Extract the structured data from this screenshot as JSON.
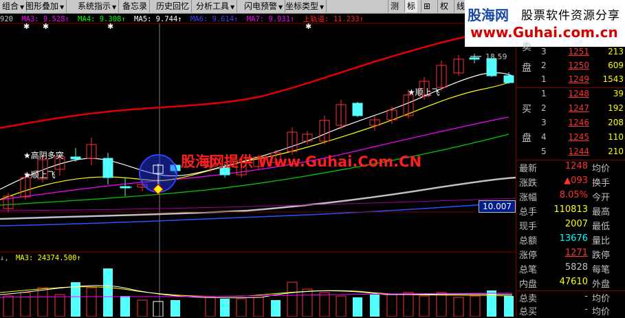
{
  "toolbar": {
    "items": [
      {
        "label": "组合"
      },
      {
        "label": "图形叠加"
      },
      {
        "label": "系统指示"
      },
      {
        "label": "备忘录"
      },
      {
        "label": "历史回忆"
      },
      {
        "label": "分析工具"
      },
      {
        "label": "闪电预警"
      },
      {
        "label": "坐标类型"
      }
    ],
    "right_items": [
      {
        "label": "测"
      },
      {
        "label": "标"
      },
      {
        "label": "⊞"
      },
      {
        "label": "权"
      },
      {
        "label": "线"
      }
    ]
  },
  "logo": {
    "brand": "股海网",
    "subtitle": "股票软件资源分享",
    "url": "www.Guhai.com.cn"
  },
  "ma_line": {
    "prefix": "920",
    "items": [
      {
        "label": "MA3: 9.528↑",
        "color": "#ff00ff"
      },
      {
        "label": "MA4: 9.308↑",
        "color": "#00ff00"
      },
      {
        "label": "MA5: 9.744↑",
        "color": "#ffffff"
      },
      {
        "label": "MA6: 9.614↑",
        "color": "#4040ff"
      },
      {
        "label": "MA7: 9.931↑",
        "color": "#ff00ff"
      },
      {
        "label": "上轨道: 11.233↑",
        "color": "#ff2020"
      }
    ]
  },
  "annotations": {
    "gaoyin": "★高阴多突",
    "shunshang_left": "★顺上飞",
    "shunshang_right": "★顺上飞",
    "high_price": "13.59",
    "watermark": "股海网提供 Www.Guhai.Com.CN",
    "price_tag": "10.007"
  },
  "volume_label": {
    "prefix": "↓,",
    "ma": "MA3: 24374.500↑"
  },
  "order_book": {
    "sell_label_1": "卖",
    "sell_label_2": "盘",
    "buy_label_1": "买",
    "buy_label_2": "盘",
    "sell": [
      {
        "level": "3",
        "price": "1251",
        "volume": "213"
      },
      {
        "level": "2",
        "price": "1250",
        "volume": "609"
      },
      {
        "level": "1",
        "price": "1249",
        "volume": "1543"
      }
    ],
    "buy": [
      {
        "level": "1",
        "price": "1248",
        "volume": "39"
      },
      {
        "level": "2",
        "price": "1247",
        "volume": "192"
      },
      {
        "level": "3",
        "price": "1246",
        "volume": "208"
      },
      {
        "level": "4",
        "price": "1245",
        "volume": "110"
      },
      {
        "level": "5",
        "price": "1244",
        "volume": "210"
      }
    ]
  },
  "stats": [
    {
      "label": "最新",
      "value": "1248",
      "value_color": "#ff3232",
      "label2": "均价"
    },
    {
      "label": "涨跌",
      "value": "▲093",
      "value_color": "#ff3232",
      "label2": "换手"
    },
    {
      "label": "涨幅",
      "value": "8.05%",
      "value_color": "#ff3232",
      "label2": "今开"
    },
    {
      "label": "总手",
      "value": "110813",
      "value_color": "#ffff00",
      "label2": "最高"
    },
    {
      "label": "现手",
      "value": "2007",
      "value_color": "#ffff00",
      "label2": "最低"
    },
    {
      "label": "总额",
      "value": "13676",
      "value_color": "#00ffff",
      "label2": "量比"
    },
    {
      "label": "涨停",
      "value": "1271",
      "value_color": "#ff3232",
      "label2": "跌停"
    },
    {
      "label": "总笔",
      "value": "5828",
      "value_color": "#c0c0c0",
      "label2": "每笔"
    },
    {
      "label": "内盘",
      "value": "47610",
      "value_color": "#ffff00",
      "label2": "外盘"
    },
    {
      "label": "总卖",
      "value": "-",
      "value_color": "#c0c0c0",
      "label2": "均价"
    },
    {
      "label": "总买",
      "value": "-",
      "value_color": "#c0c0c0",
      "label2": "均价"
    }
  ],
  "colors": {
    "up": "#ff3232",
    "down": "#54ffff",
    "upper_band": "#e00000",
    "ma_white": "#ffffff",
    "ma_yellow": "#ffff00",
    "ma_magenta": "#ff00ff",
    "ma_green": "#00cc00",
    "ma_gray": "#c0c0c0",
    "ma_blue": "#3050ff"
  }
}
